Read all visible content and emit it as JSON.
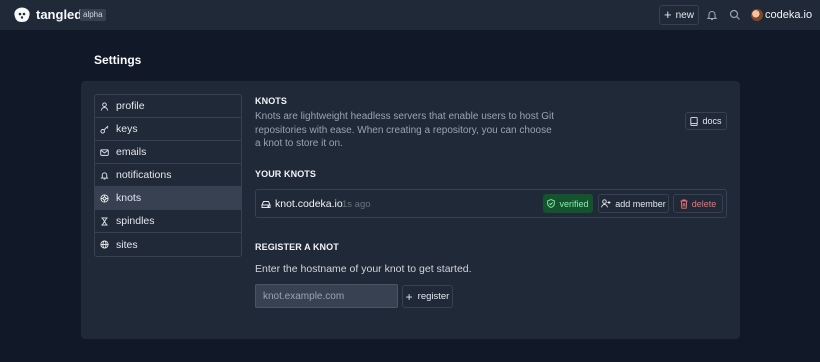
{
  "header": {
    "brand": "tangled",
    "badge": "alpha",
    "new_label": "new",
    "username": "codeka.io",
    "icons": [
      "logo-icon",
      "bell-icon",
      "search-icon",
      "avatar"
    ]
  },
  "page": {
    "title": "Settings"
  },
  "sidebar": {
    "items": [
      {
        "label": "profile",
        "icon": "user-icon"
      },
      {
        "label": "keys",
        "icon": "key-icon"
      },
      {
        "label": "emails",
        "icon": "mail-icon"
      },
      {
        "label": "notifications",
        "icon": "bell-icon"
      },
      {
        "label": "knots",
        "icon": "knot-icon",
        "active": true
      },
      {
        "label": "spindles",
        "icon": "spindle-icon"
      },
      {
        "label": "sites",
        "icon": "globe-icon"
      }
    ]
  },
  "knots": {
    "heading": "KNOTS",
    "description": "Knots are lightweight headless servers that enable users to host Git repositories with ease. When creating a repository, you can choose a knot to store it on.",
    "docs_label": "docs"
  },
  "your_knots": {
    "heading": "YOUR KNOTS",
    "items": [
      {
        "name": "knot.codeka.io",
        "time": "1s ago",
        "status": "verified",
        "add_member_label": "add member",
        "delete_label": "delete"
      }
    ]
  },
  "register": {
    "heading": "REGISTER A KNOT",
    "description": "Enter the hostname of your knot to get started.",
    "placeholder": "knot.example.com",
    "button_label": "register"
  },
  "colors": {
    "background": "#111827",
    "panel": "#1f2937",
    "verified": "#14532d",
    "danger": "#f87171"
  }
}
